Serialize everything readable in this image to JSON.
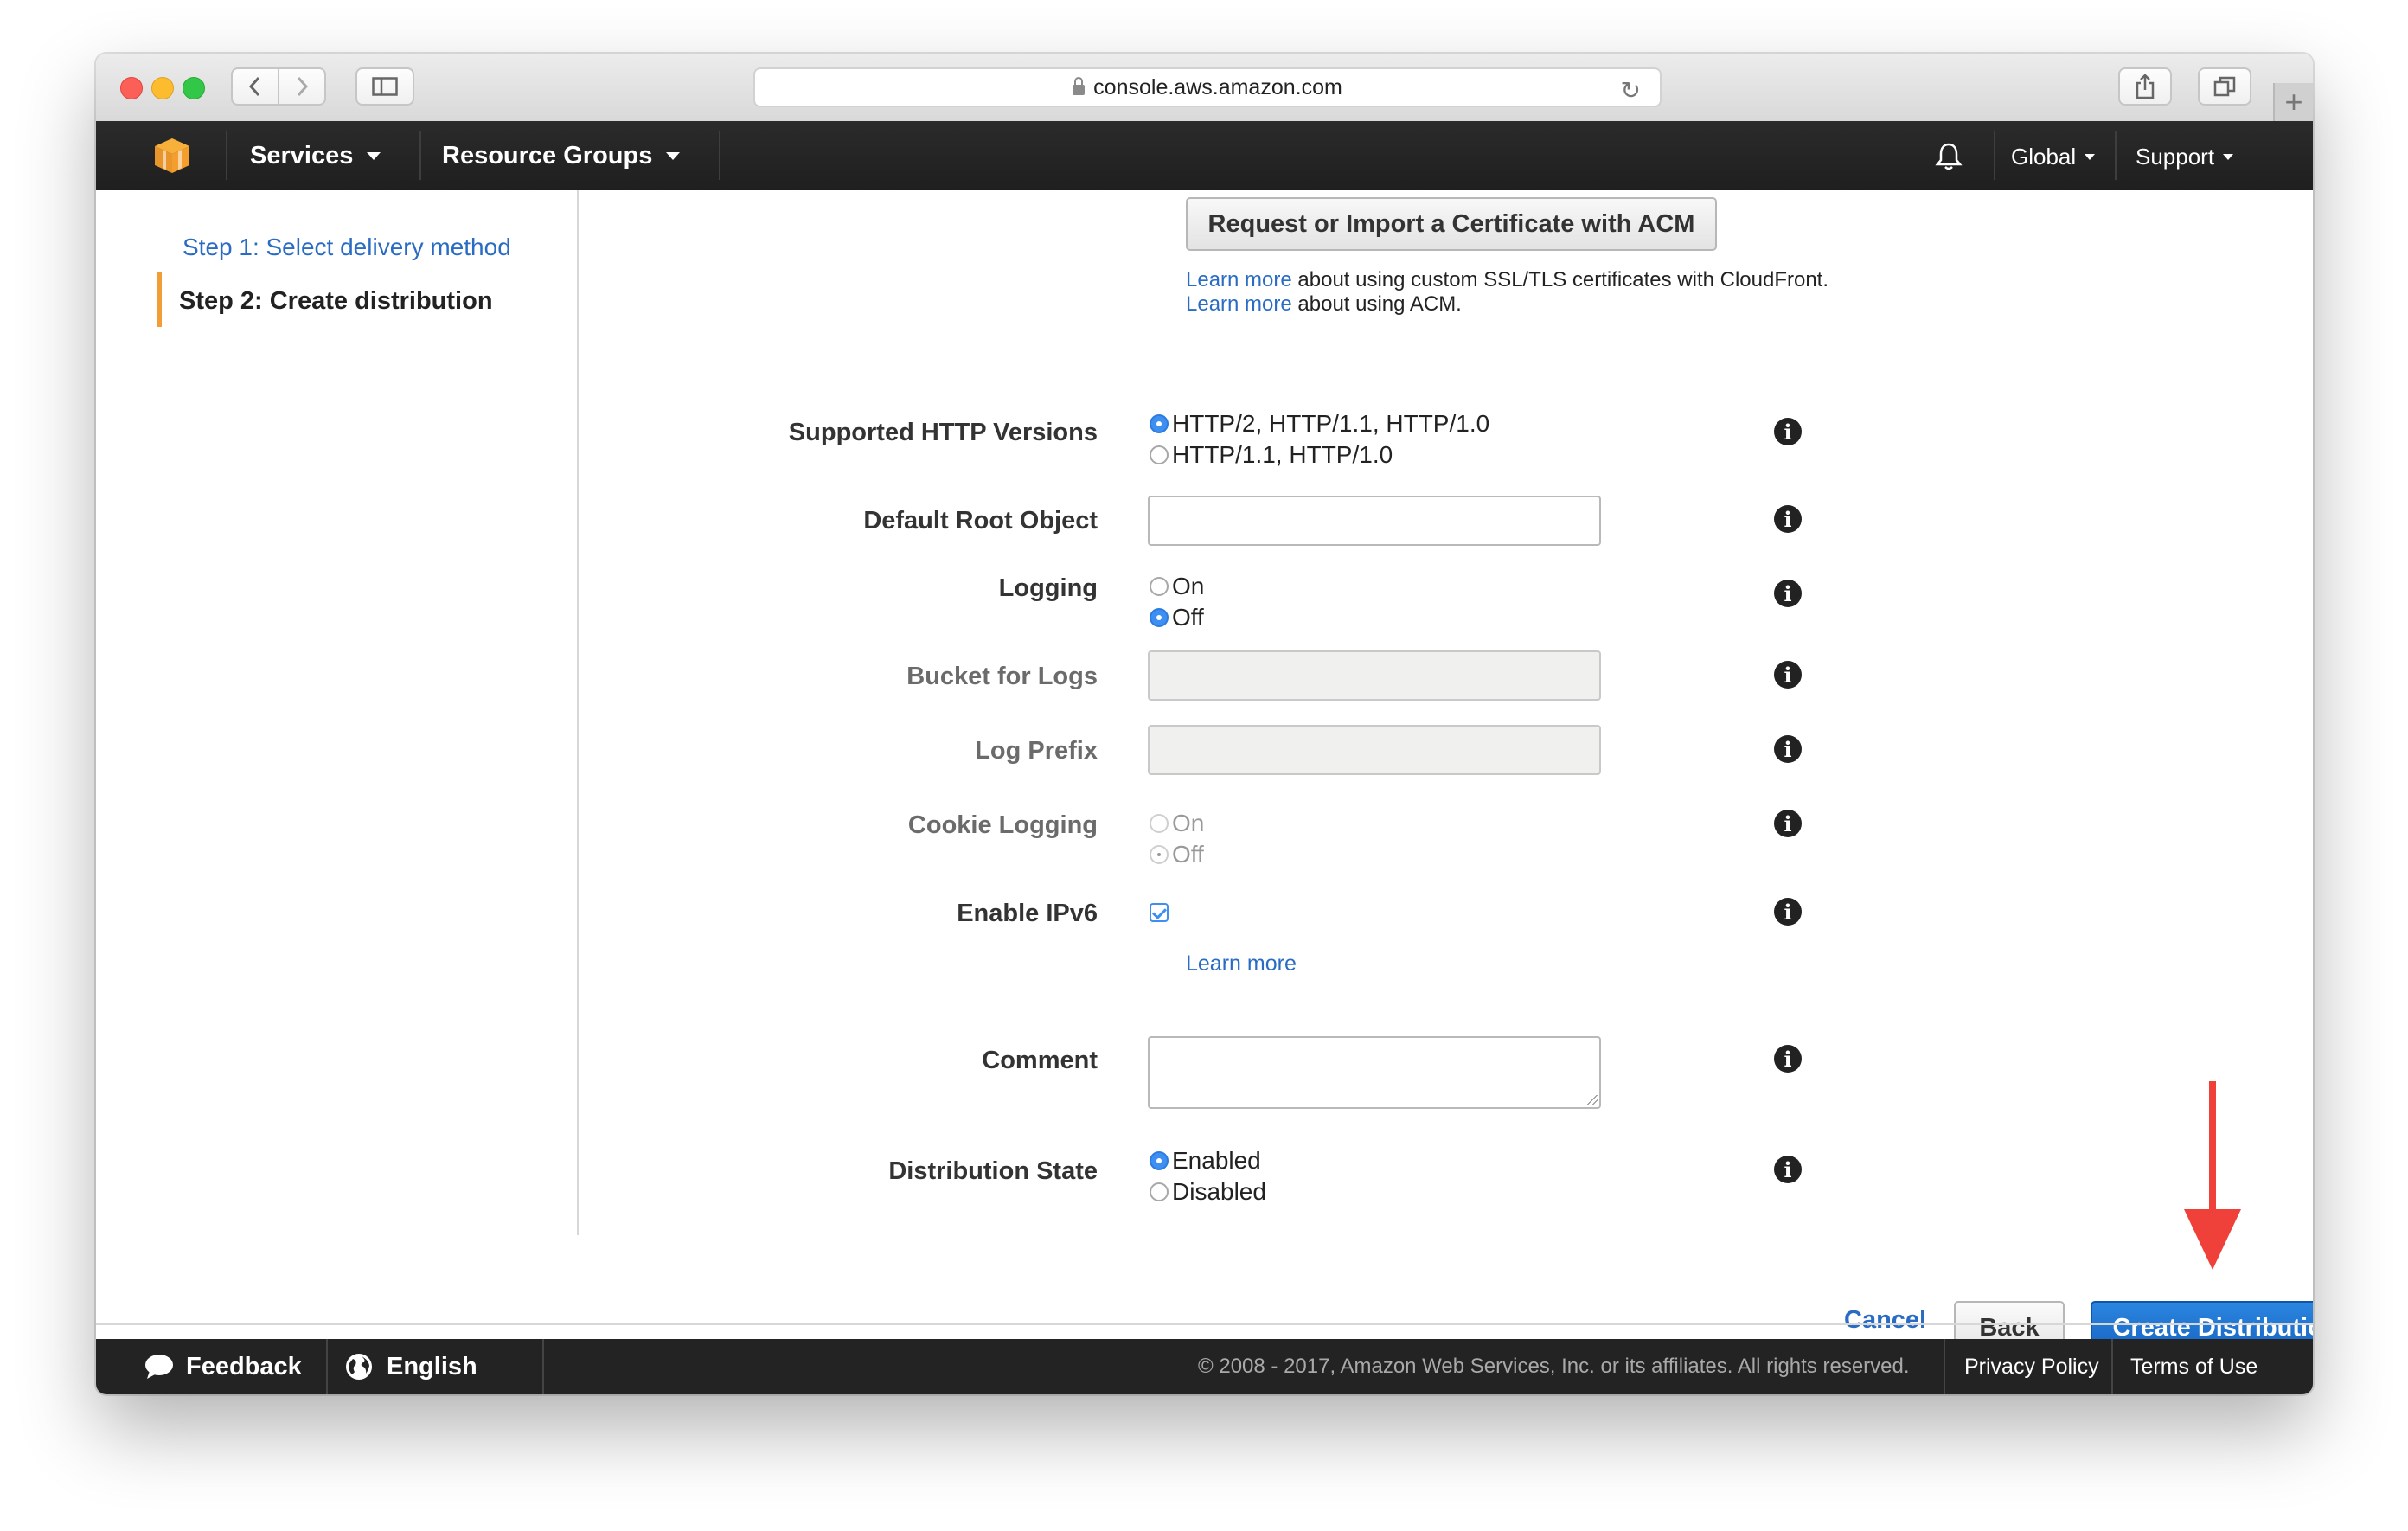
{
  "browser": {
    "url": "console.aws.amazon.com"
  },
  "nav": {
    "services": "Services",
    "resource_groups": "Resource Groups",
    "region": "Global",
    "support": "Support"
  },
  "sidebar": {
    "step1": "Step 1: Select delivery method",
    "step2": "Step 2: Create distribution"
  },
  "form": {
    "acm_button": "Request or Import a Certificate with ACM",
    "ssl_note": {
      "link": "Learn more",
      "text": " about using custom SSL/TLS certificates with CloudFront."
    },
    "acm_note": {
      "link": "Learn more",
      "text": " about using ACM."
    },
    "http_versions": {
      "label": "Supported HTTP Versions",
      "options": [
        "HTTP/2, HTTP/1.1, HTTP/1.0",
        "HTTP/1.1, HTTP/1.0"
      ],
      "selected": 0
    },
    "default_root": {
      "label": "Default Root Object",
      "value": ""
    },
    "logging": {
      "label": "Logging",
      "options": [
        "On",
        "Off"
      ],
      "selected": 1
    },
    "bucket_logs": {
      "label": "Bucket for Logs",
      "value": ""
    },
    "log_prefix": {
      "label": "Log Prefix",
      "value": ""
    },
    "cookie_logging": {
      "label": "Cookie Logging",
      "options": [
        "On",
        "Off"
      ],
      "selected": 1
    },
    "ipv6": {
      "label": "Enable IPv6",
      "checked": true,
      "learn_more": "Learn more"
    },
    "comment": {
      "label": "Comment",
      "value": ""
    },
    "distribution_state": {
      "label": "Distribution State",
      "options": [
        "Enabled",
        "Disabled"
      ],
      "selected": 0
    },
    "info_glyph": "i"
  },
  "actions": {
    "cancel": "Cancel",
    "back": "Back",
    "create": "Create Distribution"
  },
  "footer": {
    "feedback": "Feedback",
    "language": "English",
    "copyright": "© 2008 - 2017, Amazon Web Services, Inc. or its affiliates. All rights reserved.",
    "privacy": "Privacy Policy",
    "terms": "Terms of Use"
  },
  "colors": {
    "link": "#2a6cc4",
    "primary": "#1664c2",
    "accent_orange": "#f29d36",
    "annotation_arrow": "#f0403a"
  }
}
